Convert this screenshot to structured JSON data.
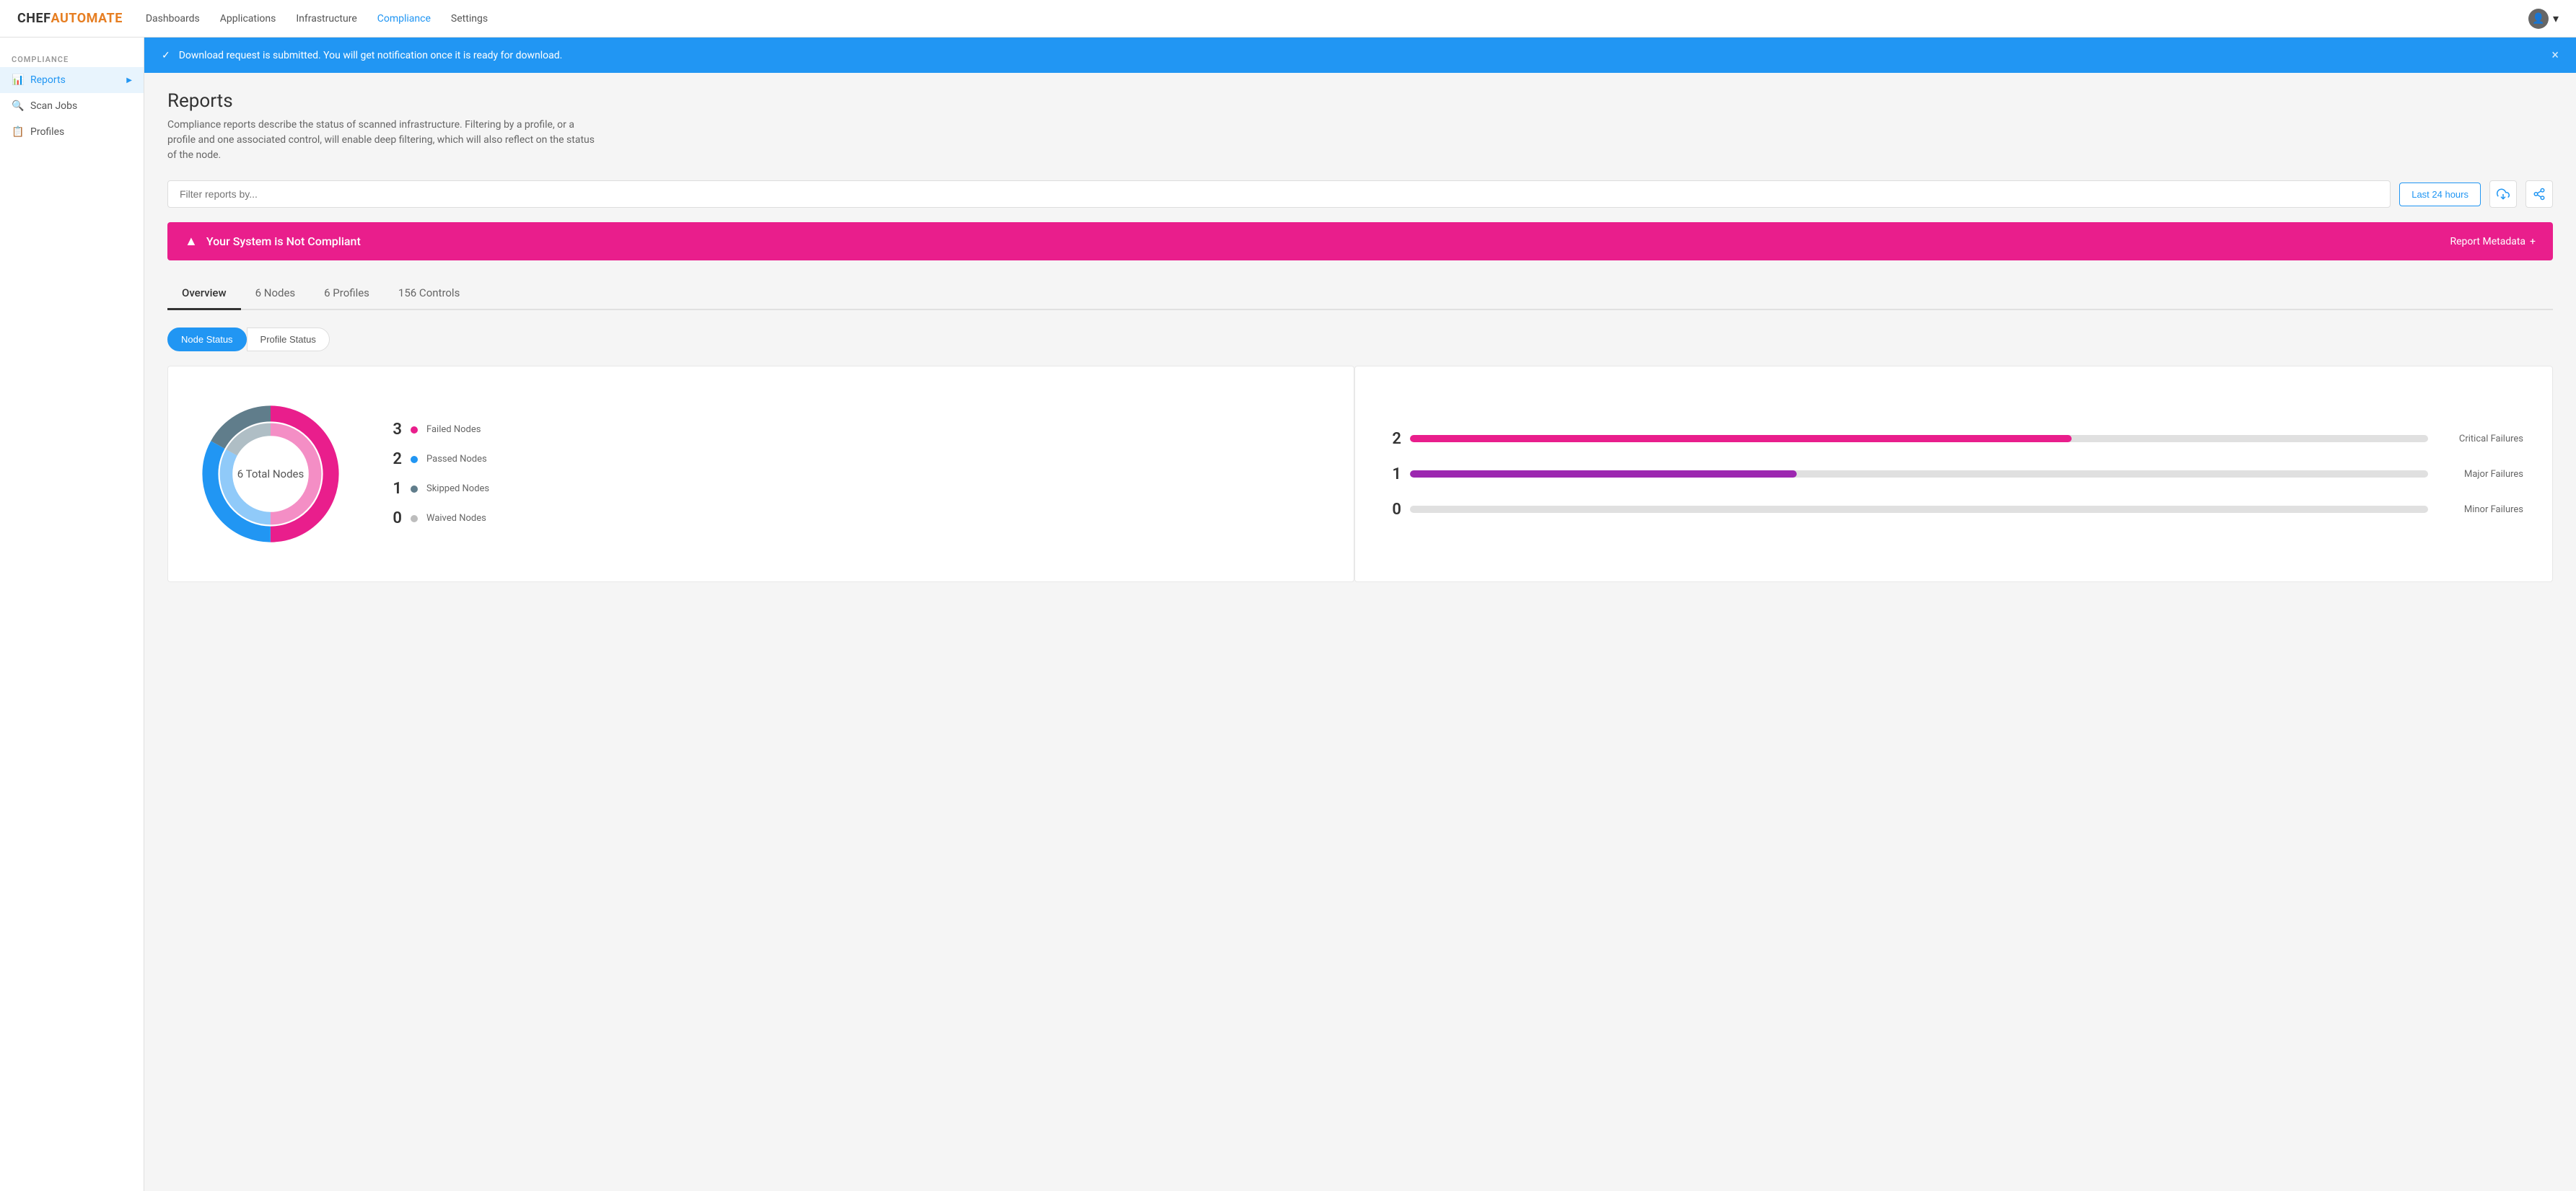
{
  "logo": {
    "chef": "CHEF",
    "automate": "AUTOMATE"
  },
  "nav": {
    "links": [
      {
        "id": "dashboards",
        "label": "Dashboards",
        "active": false
      },
      {
        "id": "applications",
        "label": "Applications",
        "active": false
      },
      {
        "id": "infrastructure",
        "label": "Infrastructure",
        "active": false
      },
      {
        "id": "compliance",
        "label": "Compliance",
        "active": true
      },
      {
        "id": "settings",
        "label": "Settings",
        "active": false
      }
    ]
  },
  "sidebar": {
    "section_label": "COMPLIANCE",
    "items": [
      {
        "id": "reports",
        "label": "Reports",
        "icon": "📊",
        "active": true,
        "has_arrow": true
      },
      {
        "id": "scan-jobs",
        "label": "Scan Jobs",
        "icon": "🔍",
        "active": false
      },
      {
        "id": "profiles",
        "label": "Profiles",
        "icon": "📋",
        "active": false
      }
    ]
  },
  "notification": {
    "message": "Download request is submitted. You will get notification once it is ready for download.",
    "close_label": "×"
  },
  "page": {
    "title": "Reports",
    "description": "Compliance reports describe the status of scanned infrastructure. Filtering by a profile, or a profile and one associated control, will enable deep filtering, which will also reflect on the status of the node.",
    "filter_placeholder": "Filter reports by...",
    "time_label": "Last 24 hours"
  },
  "compliance_banner": {
    "icon": "▲",
    "message": "Your System is Not Compliant",
    "meta_label": "Report Metadata",
    "meta_icon": "+"
  },
  "tabs": [
    {
      "id": "overview",
      "label": "Overview",
      "active": true
    },
    {
      "id": "nodes",
      "label": "6 Nodes",
      "active": false
    },
    {
      "id": "profiles_tab",
      "label": "6 Profiles",
      "active": false
    },
    {
      "id": "controls",
      "label": "156 Controls",
      "active": false
    }
  ],
  "status_toggle": {
    "buttons": [
      {
        "id": "node-status",
        "label": "Node Status",
        "active": true
      },
      {
        "id": "profile-status",
        "label": "Profile Status",
        "active": false
      }
    ]
  },
  "donut_chart": {
    "center_label": "6 Total Nodes",
    "segments": [
      {
        "label": "Failed",
        "color": "#e91e8c",
        "value": 3,
        "percentage": 50
      },
      {
        "label": "Passed",
        "color": "#2196f3",
        "value": 2,
        "percentage": 33
      },
      {
        "label": "Skipped",
        "color": "#607d8b",
        "value": 1,
        "percentage": 17
      },
      {
        "label": "Waived",
        "color": "#bdbdbd",
        "value": 0,
        "percentage": 0
      }
    ]
  },
  "legend": {
    "items": [
      {
        "id": "failed-nodes",
        "value": "3",
        "label": "Failed Nodes",
        "color": "#e91e8c"
      },
      {
        "id": "passed-nodes",
        "value": "2",
        "label": "Passed Nodes",
        "color": "#2196f3"
      },
      {
        "id": "skipped-nodes",
        "value": "1",
        "label": "Skipped Nodes",
        "color": "#607d8b"
      },
      {
        "id": "waived-nodes",
        "value": "0",
        "label": "Waived Nodes",
        "color": "#bdbdbd"
      }
    ]
  },
  "bars": {
    "items": [
      {
        "id": "critical",
        "value": "2",
        "label": "Critical Failures",
        "color": "#e91e8c",
        "fill_pct": 65
      },
      {
        "id": "major",
        "value": "1",
        "label": "Major Failures",
        "color": "#9c27b0",
        "fill_pct": 38
      },
      {
        "id": "minor",
        "value": "0",
        "label": "Minor Failures",
        "color": "#bdbdbd",
        "fill_pct": 0
      }
    ]
  }
}
